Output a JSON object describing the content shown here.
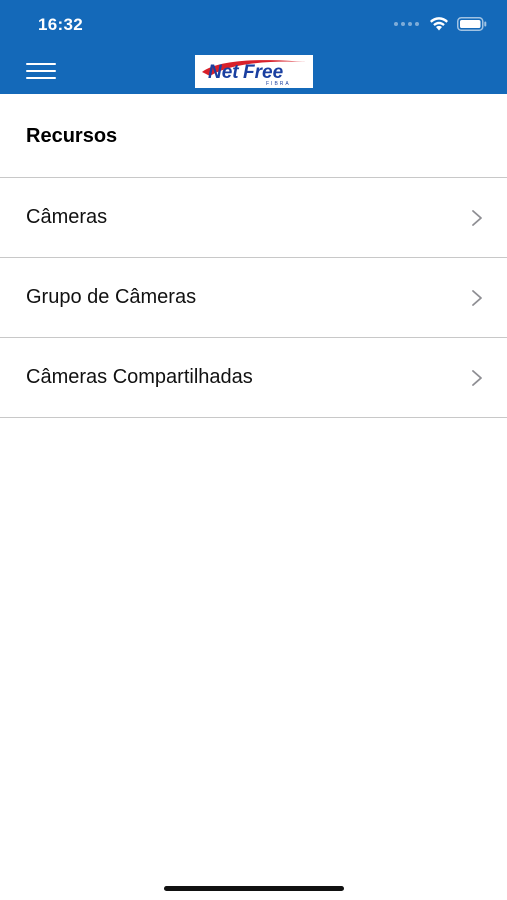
{
  "status_bar": {
    "time": "16:32"
  },
  "nav": {
    "menu_icon": "hamburger-menu-icon",
    "logo": {
      "text": "NetFree",
      "subtext": "FIBRA",
      "colors": {
        "net": "#1a3fa0",
        "swoosh": "#d8202a",
        "free": "#1a3fa0"
      }
    }
  },
  "section": {
    "title": "Recursos"
  },
  "items": [
    {
      "label": "Câmeras",
      "icon": "chevron-right-icon"
    },
    {
      "label": "Grupo de Câmeras",
      "icon": "chevron-right-icon"
    },
    {
      "label": "Câmeras Compartilhadas",
      "icon": "chevron-right-icon"
    }
  ],
  "colors": {
    "header": "#1469b9",
    "separator": "#c8c8c8",
    "chevron": "#8e8e93"
  }
}
